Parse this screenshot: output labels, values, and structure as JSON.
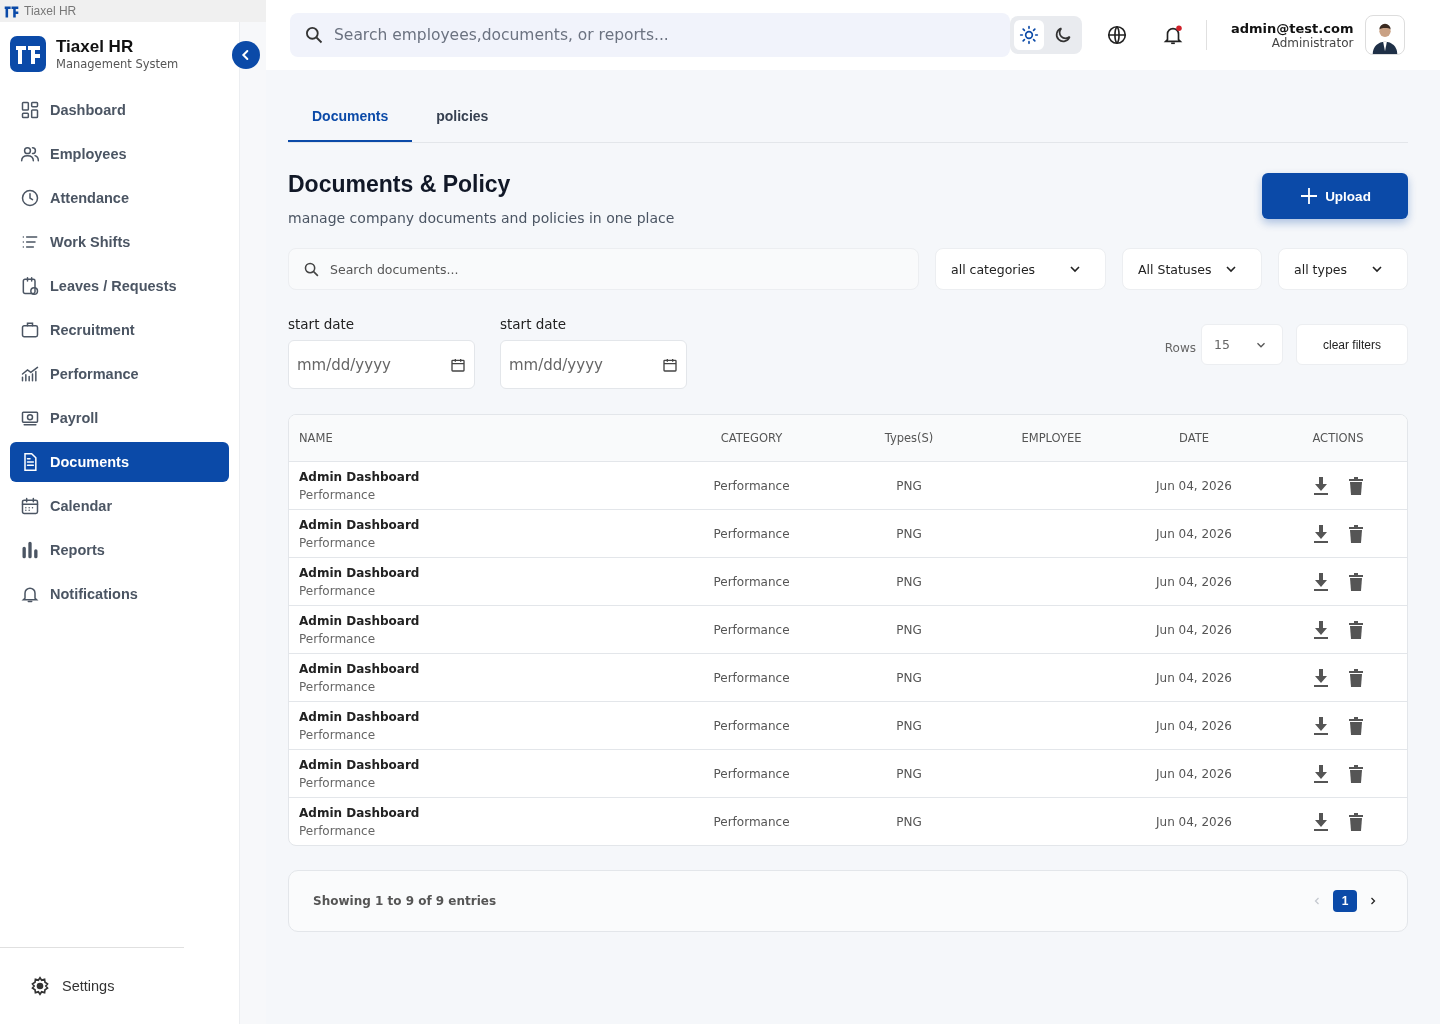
{
  "browser_tab": {
    "title": "Tiaxel HR"
  },
  "brand": {
    "name": "Tiaxel HR",
    "subtitle": "Management System"
  },
  "sidebar": {
    "items": [
      {
        "label": "Dashboard",
        "selected": false
      },
      {
        "label": "Employees",
        "selected": false
      },
      {
        "label": "Attendance",
        "selected": false
      },
      {
        "label": "Work Shifts",
        "selected": false
      },
      {
        "label": "Leaves / Requests",
        "selected": false
      },
      {
        "label": "Recruitment",
        "selected": false
      },
      {
        "label": "Performance",
        "selected": false
      },
      {
        "label": "Payroll",
        "selected": false
      },
      {
        "label": "Documents",
        "selected": true
      },
      {
        "label": "Calendar",
        "selected": false
      },
      {
        "label": "Reports",
        "selected": false
      },
      {
        "label": "Notifications",
        "selected": false
      }
    ],
    "footer": {
      "label": "Settings"
    }
  },
  "header": {
    "search": {
      "placeholder": "Search employees,documents, or reports..."
    },
    "theme_modes": [
      {
        "kind": "light",
        "selected": true
      },
      {
        "kind": "dark",
        "selected": false
      }
    ],
    "notifications": {
      "unread": true
    },
    "user": {
      "email": "admin@test.com",
      "role": "Administrator"
    }
  },
  "tabs": [
    {
      "label": "Documents",
      "selected": true
    },
    {
      "label": "policies",
      "selected": false
    }
  ],
  "page": {
    "title": "Documents & Policy",
    "subtitle": "manage company documents and policies in one place",
    "upload_button": "Upload"
  },
  "filters": {
    "search": {
      "placeholder": "Search documents..."
    },
    "dropdowns": [
      {
        "value": "all categories"
      },
      {
        "value": "All Statuses"
      },
      {
        "value": "all types"
      }
    ],
    "dates": [
      {
        "label": "start date",
        "placeholder": "mm/dd/yyyy"
      },
      {
        "label": "start date",
        "placeholder": "mm/dd/yyyy"
      }
    ],
    "rows": {
      "label": "Rows",
      "value": "15"
    },
    "clear_button": "clear filters"
  },
  "table": {
    "columns": [
      "NAME",
      "CATEGORY",
      "Types(S)",
      "EMPLOYEE",
      "DATE",
      "ACTIONS"
    ],
    "rows": [
      {
        "name": "Admin Dashboard",
        "subtitle": "Performance",
        "category": "Performance",
        "type": "PNG",
        "date": "Jun 04, 2026"
      },
      {
        "name": "Admin Dashboard",
        "subtitle": "Performance",
        "category": "Performance",
        "type": "PNG",
        "date": "Jun 04, 2026"
      },
      {
        "name": "Admin Dashboard",
        "subtitle": "Performance",
        "category": "Performance",
        "type": "PNG",
        "date": "Jun 04, 2026"
      },
      {
        "name": "Admin Dashboard",
        "subtitle": "Performance",
        "category": "Performance",
        "type": "PNG",
        "date": "Jun 04, 2026"
      },
      {
        "name": "Admin Dashboard",
        "subtitle": "Performance",
        "category": "Performance",
        "type": "PNG",
        "date": "Jun 04, 2026"
      },
      {
        "name": "Admin Dashboard",
        "subtitle": "Performance",
        "category": "Performance",
        "type": "PNG",
        "date": "Jun 04, 2026"
      },
      {
        "name": "Admin Dashboard",
        "subtitle": "Performance",
        "category": "Performance",
        "type": "PNG",
        "date": "Jun 04, 2026"
      },
      {
        "name": "Admin Dashboard",
        "subtitle": "Performance",
        "category": "Performance",
        "type": "PNG",
        "date": "Jun 04, 2026"
      }
    ]
  },
  "pagination": {
    "summary": "Showing 1 to 9 of 9 entries",
    "prev_disabled": true,
    "pages": [
      {
        "label": "1",
        "selected": true
      }
    ]
  }
}
